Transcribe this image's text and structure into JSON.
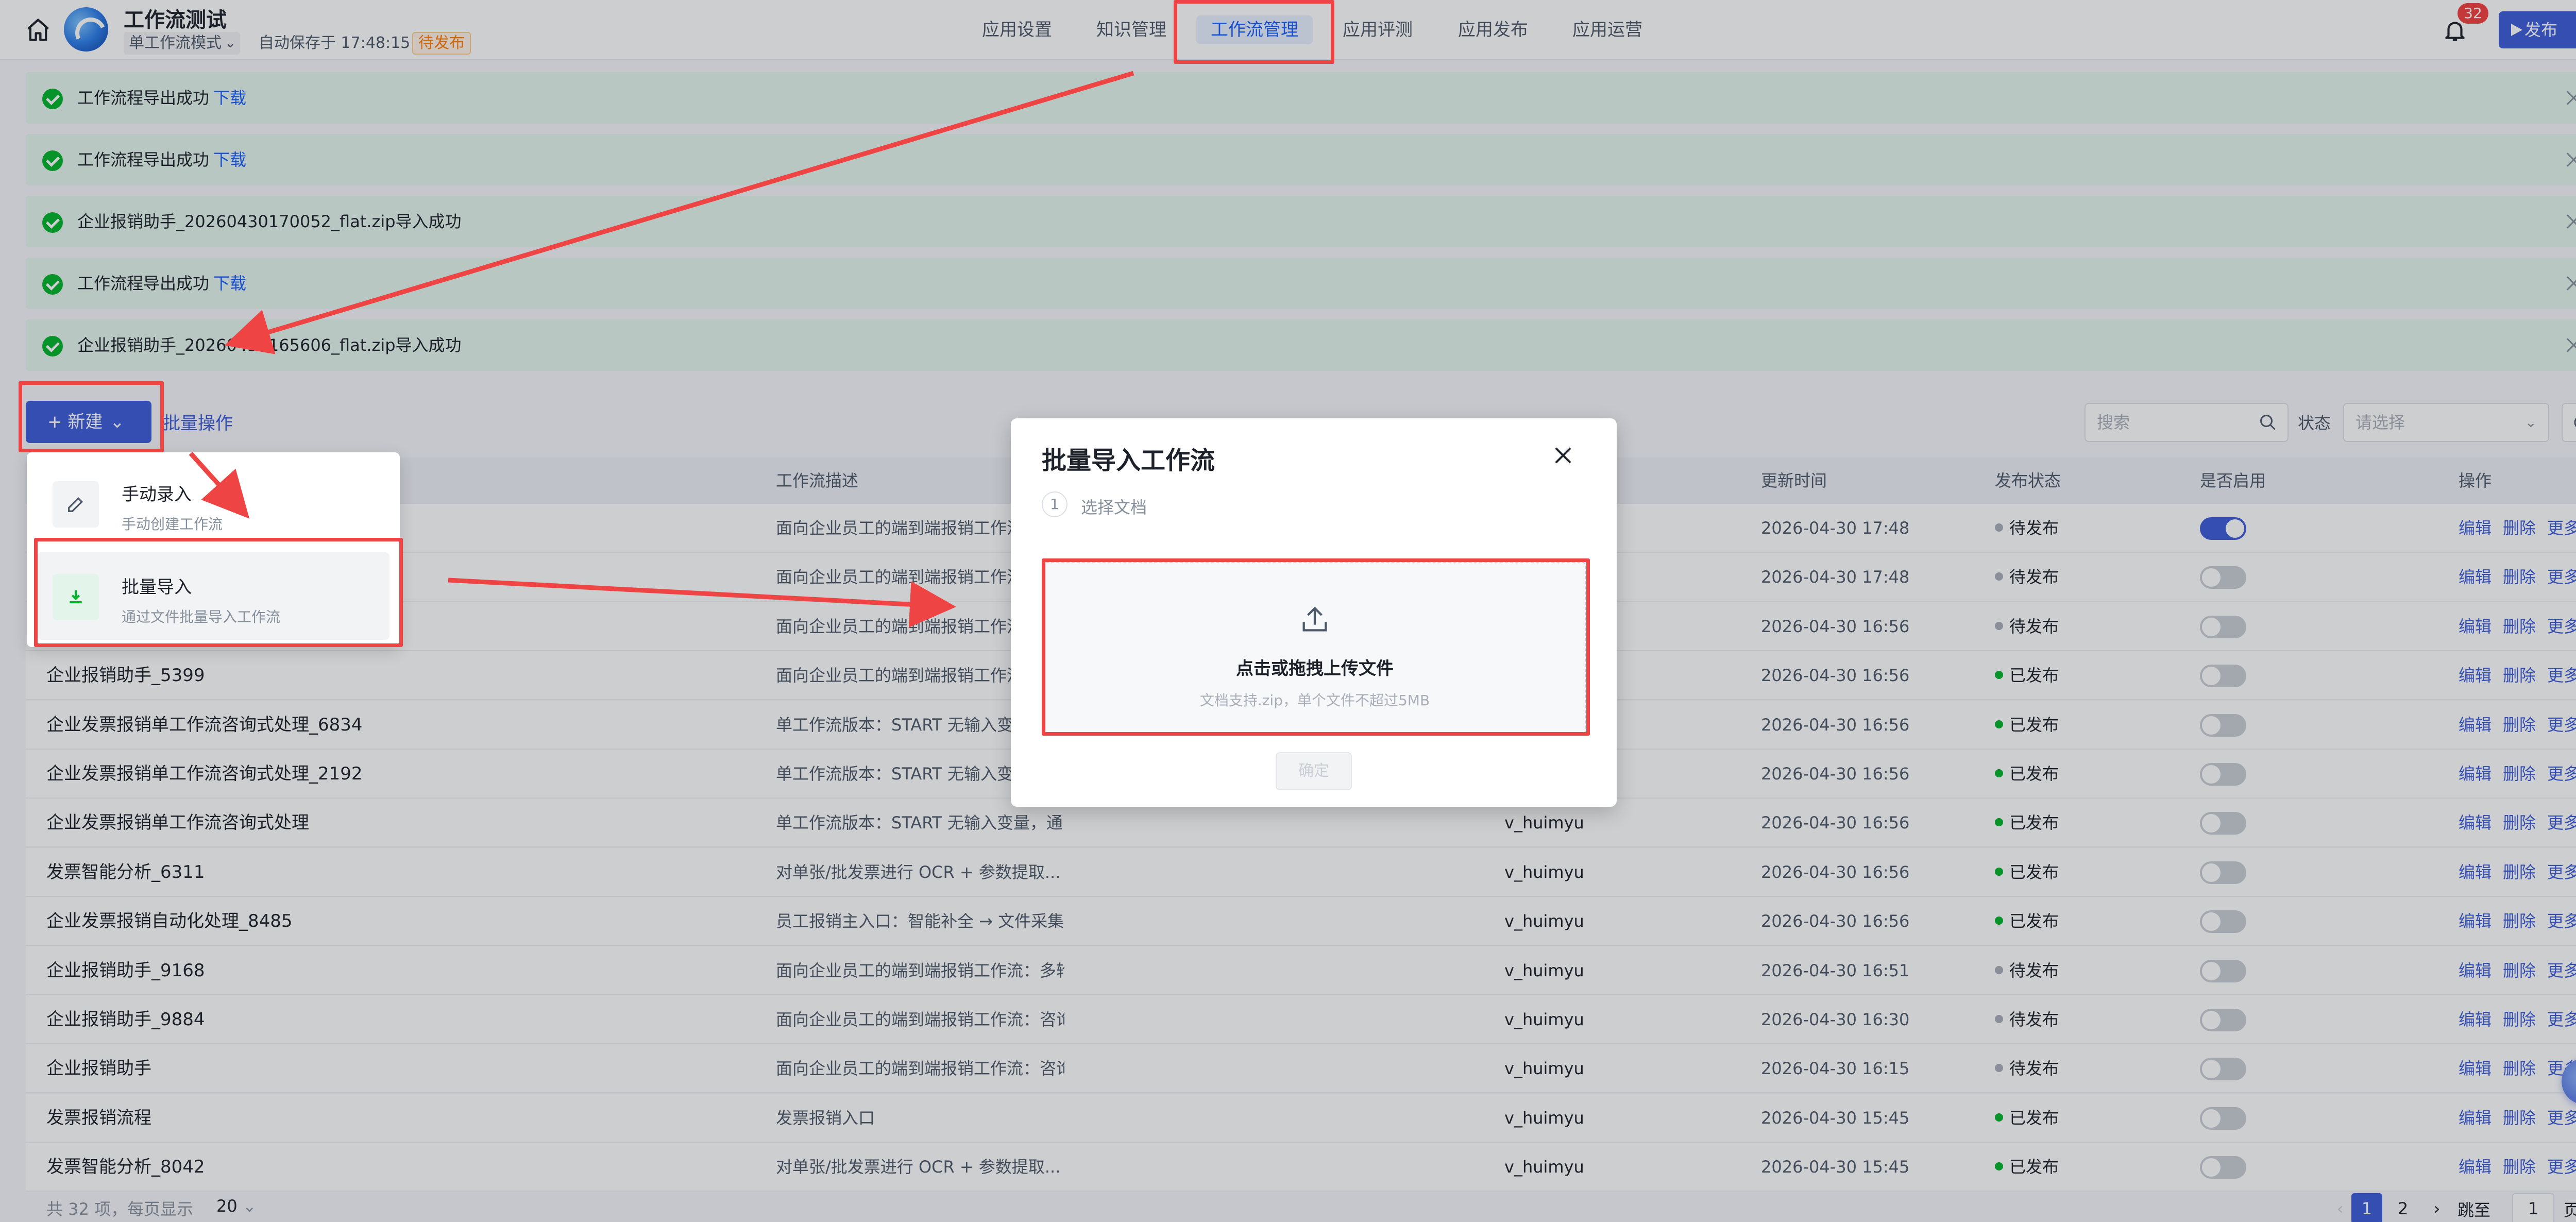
{
  "header": {
    "app_title": "工作流测试",
    "mode": "单工作流模式",
    "autosave": "自动保存于 17:48:15",
    "status_tag": "待发布",
    "nav": [
      "应用设置",
      "知识管理",
      "工作流管理",
      "应用评测",
      "应用发布",
      "应用运营"
    ],
    "active_nav": "工作流管理",
    "notification_count": "32",
    "publish_label": "发布"
  },
  "notices": [
    {
      "text": "工作流程导出成功",
      "link": "下载"
    },
    {
      "text": "工作流程导出成功",
      "link": "下载"
    },
    {
      "text": "企业报销助手_20260430170052_flat.zip导入成功",
      "link": ""
    },
    {
      "text": "工作流程导出成功",
      "link": "下载"
    },
    {
      "text": "企业报销助手_20260430165606_flat.zip导入成功",
      "link": ""
    }
  ],
  "toolbar": {
    "new_label": "新建",
    "batch_label": "批量操作",
    "search_placeholder": "搜索",
    "status_label": "状态",
    "status_placeholder": "请选择"
  },
  "dropdown": {
    "items": [
      {
        "title": "手动录入",
        "subtitle": "手动创建工作流"
      },
      {
        "title": "批量导入",
        "subtitle": "通过文件批量导入工作流"
      }
    ]
  },
  "table": {
    "headers": [
      "工作流描述",
      "更新时间",
      "发布状态",
      "是否启用",
      "操作"
    ],
    "actions": [
      "编辑",
      "删除",
      "更多"
    ],
    "rows": [
      {
        "name": "",
        "desc": "面向企业员工的端到端报销工作流",
        "owner": "",
        "time": "2026-04-30 17:48",
        "status": "待发布",
        "enabled": true
      },
      {
        "name": "",
        "desc": "面向企业员工的端到端报销工作流",
        "owner": "",
        "time": "2026-04-30 17:48",
        "status": "待发布",
        "enabled": false
      },
      {
        "name": "",
        "desc": "面向企业员工的端到端报销工作流",
        "owner": "",
        "time": "2026-04-30 16:56",
        "status": "待发布",
        "enabled": false
      },
      {
        "name": "企业报销助手_5399",
        "desc": "面向企业员工的端到端报销工作流",
        "owner": "",
        "time": "2026-04-30 16:56",
        "status": "已发布",
        "enabled": false
      },
      {
        "name": "企业发票报销单工作流咨询式处理_6834",
        "desc": "单工作流版本：START 无输入变量",
        "owner": "",
        "time": "2026-04-30 16:56",
        "status": "已发布",
        "enabled": false
      },
      {
        "name": "企业发票报销单工作流咨询式处理_2192",
        "desc": "单工作流版本：START 无输入变量",
        "owner": "",
        "time": "2026-04-30 16:56",
        "status": "已发布",
        "enabled": false
      },
      {
        "name": "企业发票报销单工作流咨询式处理",
        "desc": "单工作流版本：START 无输入变量，通...",
        "owner": "v_huimyu",
        "time": "2026-04-30 16:56",
        "status": "已发布",
        "enabled": false
      },
      {
        "name": "发票智能分析_6311",
        "desc": "对单张/批发票进行 OCR + 参数提取...",
        "owner": "v_huimyu",
        "time": "2026-04-30 16:56",
        "status": "已发布",
        "enabled": false
      },
      {
        "name": "企业发票报销自动化处理_8485",
        "desc": "员工报销主入口：智能补全 → 文件采集 ...",
        "owner": "v_huimyu",
        "time": "2026-04-30 16:56",
        "status": "已发布",
        "enabled": false
      },
      {
        "name": "企业报销助手_9168",
        "desc": "面向企业员工的端到端报销工作流：多轮咨询...",
        "owner": "v_huimyu",
        "time": "2026-04-30 16:51",
        "status": "待发布",
        "enabled": false
      },
      {
        "name": "企业报销助手_9884",
        "desc": "面向企业员工的端到端报销工作流：咨询信息...",
        "owner": "v_huimyu",
        "time": "2026-04-30 16:30",
        "status": "待发布",
        "enabled": false
      },
      {
        "name": "企业报销助手",
        "desc": "面向企业员工的端到端报销工作流：咨询信息...",
        "owner": "v_huimyu",
        "time": "2026-04-30 16:15",
        "status": "待发布",
        "enabled": false
      },
      {
        "name": "发票报销流程",
        "desc": "发票报销入口",
        "owner": "v_huimyu",
        "time": "2026-04-30 15:45",
        "status": "已发布",
        "enabled": false
      },
      {
        "name": "发票智能分析_8042",
        "desc": "对单张/批发票进行 OCR + 参数提取...",
        "owner": "v_huimyu",
        "time": "2026-04-30 15:45",
        "status": "已发布",
        "enabled": false
      }
    ]
  },
  "status_colors": {
    "待发布": "#a9aeb8",
    "已发布": "#00b42a"
  },
  "modal": {
    "title": "批量导入工作流",
    "step_number": "1",
    "step_label": "选择文档",
    "upload_main": "点击或拖拽上传文件",
    "upload_sub": "文档支持.zip，单个文件不超过5MB",
    "confirm_label": "确定"
  },
  "pagination": {
    "total": "共 32 项，每页显示",
    "page_size": "20",
    "pages": [
      "1",
      "2"
    ],
    "current": "1",
    "jump_label": "跳至",
    "jump_value": "1",
    "page_unit": "页"
  }
}
